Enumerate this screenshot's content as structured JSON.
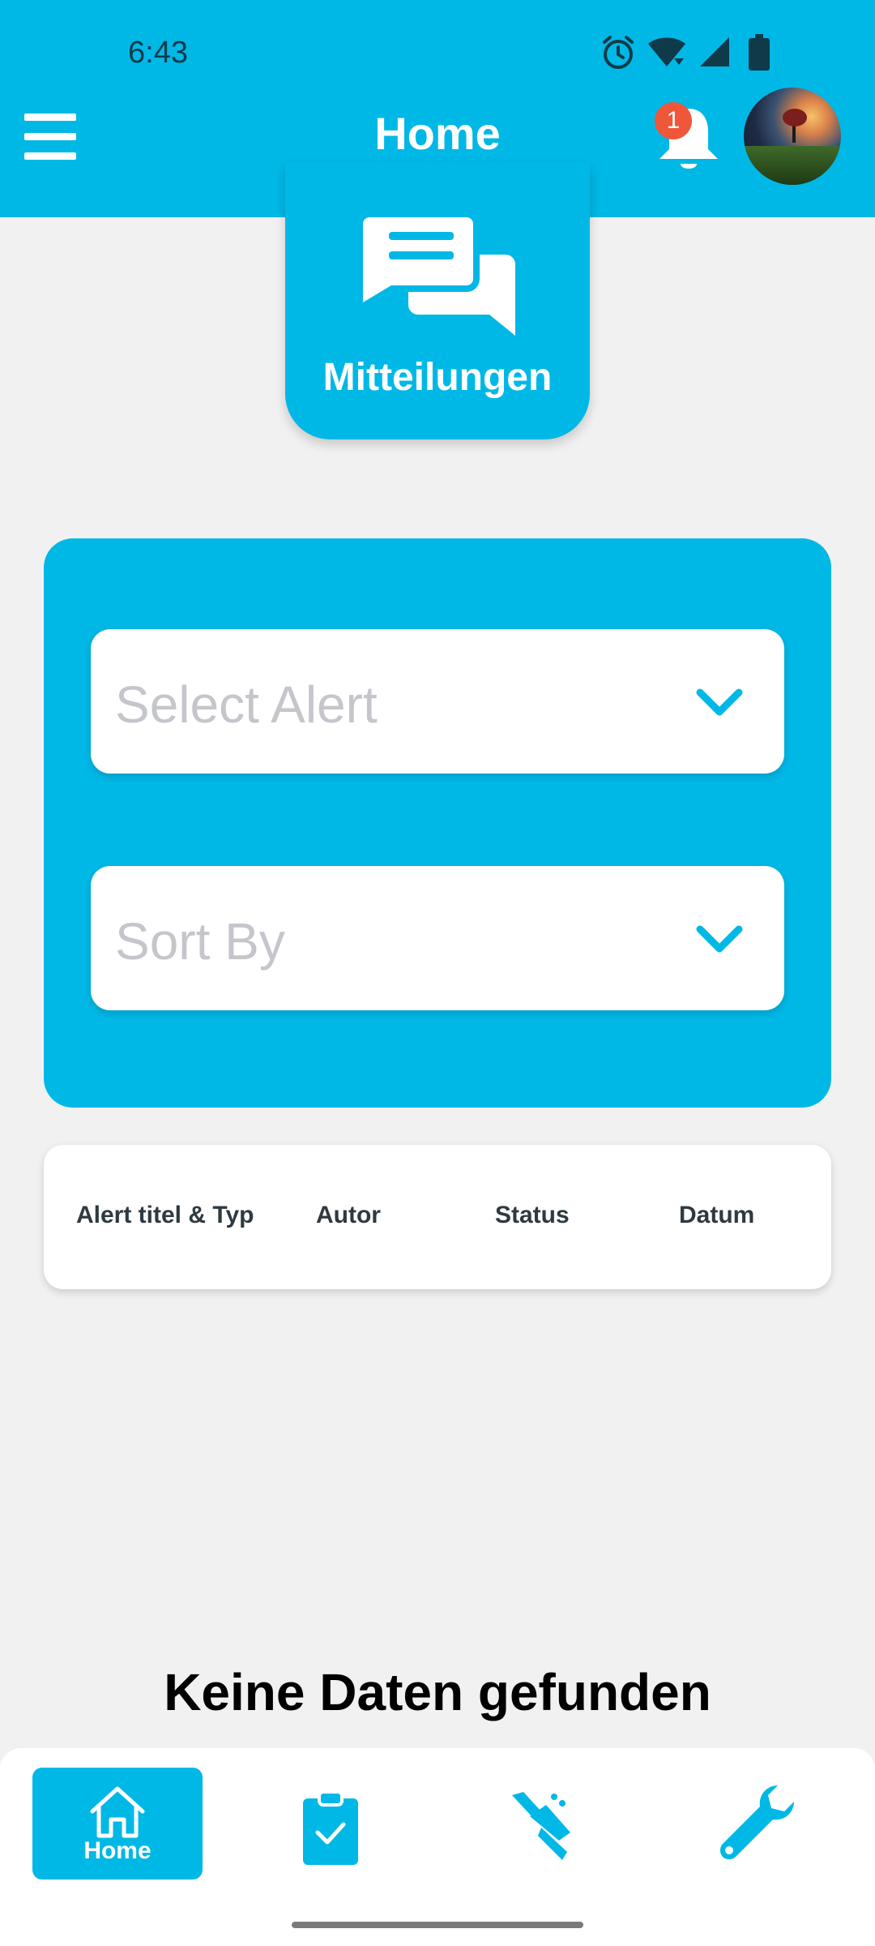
{
  "status_bar": {
    "time": "6:43",
    "icons": [
      "alarm-icon",
      "wifi-icon",
      "signal-icon",
      "battery-icon"
    ]
  },
  "header": {
    "title": "Home",
    "menu_icon": "hamburger-menu-icon",
    "notification_icon": "bell-icon",
    "notification_count": "1"
  },
  "mitteilungen": {
    "label": "Mitteilungen",
    "icon": "chat-bubbles-icon"
  },
  "filters": {
    "select_alert": {
      "placeholder": "Select Alert",
      "icon": "chevron-down-icon"
    },
    "sort_by": {
      "placeholder": "Sort By",
      "icon": "chevron-down-icon"
    }
  },
  "table": {
    "columns": [
      "Alert titel & Typ",
      "Autor",
      "Status",
      "Datum"
    ]
  },
  "empty_message": "Keine Daten gefunden",
  "bottom_nav": {
    "home_label": "Home",
    "items": [
      "home-icon",
      "clipboard-check-icon",
      "handshake-icon",
      "wrench-icon"
    ]
  },
  "colors": {
    "primary": "#00B8E6",
    "background": "#F1F1F1",
    "badge": "#F0563A",
    "placeholder": "#C4C6CC"
  }
}
